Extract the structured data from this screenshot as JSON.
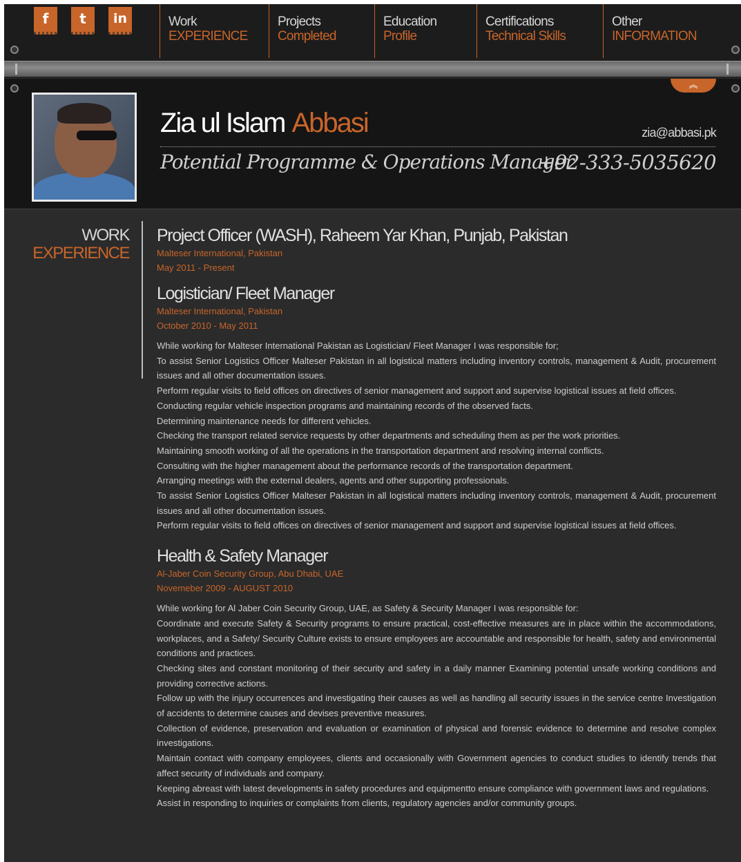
{
  "social": [
    {
      "icon": "facebook-icon",
      "glyph": "f"
    },
    {
      "icon": "twitter-icon",
      "glyph": "t"
    },
    {
      "icon": "linkedin-icon",
      "glyph": "in"
    }
  ],
  "nav": [
    {
      "top": "Work",
      "bottom": "EXPERIENCE"
    },
    {
      "top": "Projects",
      "bottom": "Completed"
    },
    {
      "top": "Education",
      "bottom": "Profile"
    },
    {
      "top": "Certifications",
      "bottom": "Technical Skills"
    },
    {
      "top": "Other",
      "bottom": "INFORMATION"
    }
  ],
  "header": {
    "first_name": "Zia ul Islam",
    "last_name": "Abbasi",
    "email": "zia@abbasi.pk",
    "tagline": "Potential Programme & Operations Manager",
    "phone": "+92-333-5035620",
    "collapse_glyph": "︽"
  },
  "section": {
    "label_top": "WORK",
    "label_bottom": "EXPERIENCE"
  },
  "jobs": [
    {
      "title": "Project Officer (WASH), Raheem Yar Khan, Punjab, Pakistan",
      "org": "Malteser International, Pakistan",
      "date": "May 2011 - Present",
      "lines": []
    },
    {
      "title": "Logistician/ Fleet Manager",
      "org": "Malteser International, Pakistan",
      "date": "October 2010 - May 2011",
      "lines": [
        "While working for Malteser International Pakistan as Logistician/ Fleet Manager I was responsible for;",
        "To assist Senior Logistics Officer Malteser Pakistan in all logistical matters including inventory controls, management & Audit, procurement issues and all other documentation issues.",
        "Perform regular visits to field offices on directives of senior management and support and supervise logistical issues at field offices.",
        "Conducting regular vehicle inspection programs and maintaining records of the observed facts.",
        "Determining maintenance needs for different vehicles.",
        "Checking the transport related service requests by other departments and scheduling them as per the work priorities.",
        "Maintaining smooth working of all the operations in the transportation department and resolving internal conflicts.",
        "Consulting with the higher management about the performance records of the transportation department.",
        "Arranging meetings with the external dealers, agents and other supporting professionals.",
        "To assist Senior Logistics Officer Malteser Pakistan in all logistical matters including inventory controls, management & Audit, procurement issues and all other documentation issues.",
        "Perform regular visits to field offices on directives of senior management and support and supervise logistical issues at field offices."
      ]
    },
    {
      "title": "Health & Safety Manager",
      "org": "Al-Jaber Coin Security Group, Abu Dhabi, UAE",
      "date": "Novemeber 2009 - AUGUST 2010",
      "lines": [
        "While working for Al Jaber Coin Security Group, UAE, as Safety & Security Manager I was responsible for:",
        "Coordinate and execute Safety & Security programs to ensure practical, cost-effective measures are in place within the accommodations, workplaces, and a Safety/ Security Culture exists to ensure employees are accountable and responsible for health, safety and environmental conditions and practices.",
        "Checking sites and constant monitoring of their security and safety in a daily manner Examining potential unsafe working conditions and providing corrective actions.",
        "Follow up with the injury occurrences and investigating their causes as well as handling all security issues in the service centre Investigation of accidents to determine causes and devises preventive measures.",
        "Collection of evidence, preservation and evaluation or examination of physical and forensic evidence to determine and resolve complex investigations.",
        "Maintain contact with company employees, clients and occasionally with Government agencies to conduct studies to identify trends that affect security of individuals and company.",
        "Keeping abreast with latest developments in safety procedures and equipmentto ensure compliance with government laws and regulations.",
        "Assist in responding to inquiries or complaints from clients, regulatory agencies and/or community groups."
      ]
    }
  ]
}
